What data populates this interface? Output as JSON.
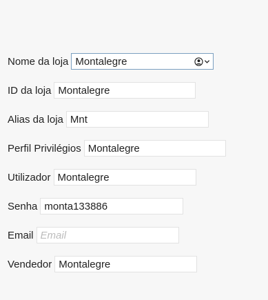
{
  "form": {
    "nome_da_loja": {
      "label": "Nome da loja",
      "value": "Montalegre"
    },
    "id_da_loja": {
      "label": "ID da loja",
      "value": "Montalegre"
    },
    "alias_da_loja": {
      "label": "Alias da loja",
      "value": "Mnt"
    },
    "perfil_privilegios": {
      "label": "Perfil Privilégios",
      "value": "Montalegre"
    },
    "utilizador": {
      "label": "Utilizador",
      "value": "Montalegre"
    },
    "senha": {
      "label": "Senha",
      "value": "monta133886"
    },
    "email": {
      "label": "Email",
      "value": "",
      "placeholder": "Email"
    },
    "vendedor": {
      "label": "Vendedor",
      "value": "Montalegre"
    }
  },
  "icons": {
    "select_icon": "user-circle-icon",
    "dropdown_icon": "chevron-down-icon"
  }
}
